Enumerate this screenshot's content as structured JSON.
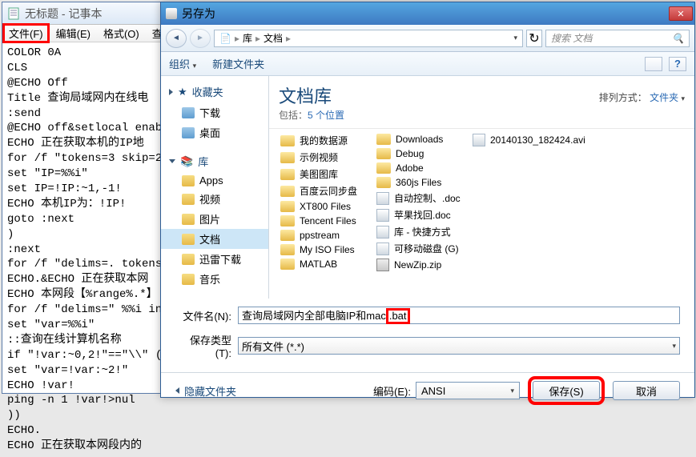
{
  "notepad": {
    "title": "无标题 - 记事本",
    "menubar": {
      "file": "文件(F)",
      "edit": "编辑(E)",
      "format": "格式(O)",
      "view": "查看"
    },
    "content": "COLOR 0A\nCLS\n@ECHO Off\nTitle 查询局域网内在线电\n:send\n@ECHO off&setlocal enab\nECHO 正在获取本机的IP地\nfor /f \"tokens=3 skip=2\nset \"IP=%%i\"\nset IP=!IP:~1,-1!\nECHO 本机IP为：!IP!\ngoto :next\n)\n:next\nfor /f \"delims=. tokens\nECHO.&ECHO 正在获取本网\nECHO 本网段【%range%.*】\nfor /f \"delims=\" %%i in\nset \"var=%%i\"\n::查询在线计算机名称\nif \"!var:~0,2!\"==\"\\\\\" (\nset \"var=!var:~2!\"\nECHO !var!\nping -n 1 !var!>nul\n))\nECHO.\nECHO 正在获取本网段内的"
  },
  "dialog": {
    "title": "另存为",
    "nav": {
      "breadcrumb": [
        "库",
        "文档"
      ],
      "search_placeholder": "搜索 文档"
    },
    "toolbar": {
      "organize": "组织",
      "new_folder": "新建文件夹"
    },
    "sidebar": {
      "favorites": {
        "label": "收藏夹",
        "items": [
          "下载",
          "桌面"
        ]
      },
      "libraries": {
        "label": "库",
        "items": [
          "Apps",
          "视频",
          "图片",
          "文档",
          "迅雷下载",
          "音乐"
        ]
      }
    },
    "main": {
      "title": "文档库",
      "subtitle_prefix": "包括：",
      "subtitle_link": "5 个位置",
      "sort_label": "排列方式：",
      "sort_value": "文件夹",
      "col1": [
        "我的数据源",
        "示例视频",
        "美图图库",
        "百度云同步盘",
        "XT800 Files",
        "Tencent Files",
        "ppstream",
        "My ISO Files",
        "MATLAB"
      ],
      "col2": [
        "Downloads",
        "Debug",
        "Adobe",
        "360js Files",
        "自动控制、.doc",
        "苹果找回.doc",
        "库 - 快捷方式",
        "可移动磁盘 (G)",
        "NewZip.zip"
      ],
      "col3": [
        "20140130_182424.avi"
      ]
    },
    "fields": {
      "filename_label": "文件名(N):",
      "filename_value_pre": "查询局域网内全部电脑IP和mac",
      "filename_value_hl": ".bat",
      "filetype_label": "保存类型(T):",
      "filetype_value": "所有文件 (*.*)"
    },
    "footer": {
      "hide_folders": "隐藏文件夹",
      "encoding_label": "编码(E):",
      "encoding_value": "ANSI",
      "save": "保存(S)",
      "cancel": "取消"
    }
  }
}
